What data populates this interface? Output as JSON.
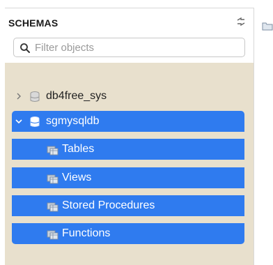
{
  "sidebar": {
    "title": "SCHEMAS",
    "filter_placeholder": "Filter objects",
    "schemas": [
      {
        "name": "db4free_sys",
        "expanded": false,
        "selected": false
      },
      {
        "name": "sgmysqldb",
        "expanded": true,
        "selected": true,
        "children": [
          "Tables",
          "Views",
          "Stored Procedures",
          "Functions"
        ]
      }
    ]
  },
  "colors": {
    "selection": "#2f7bef",
    "tree_background": "#e8e0cd"
  }
}
